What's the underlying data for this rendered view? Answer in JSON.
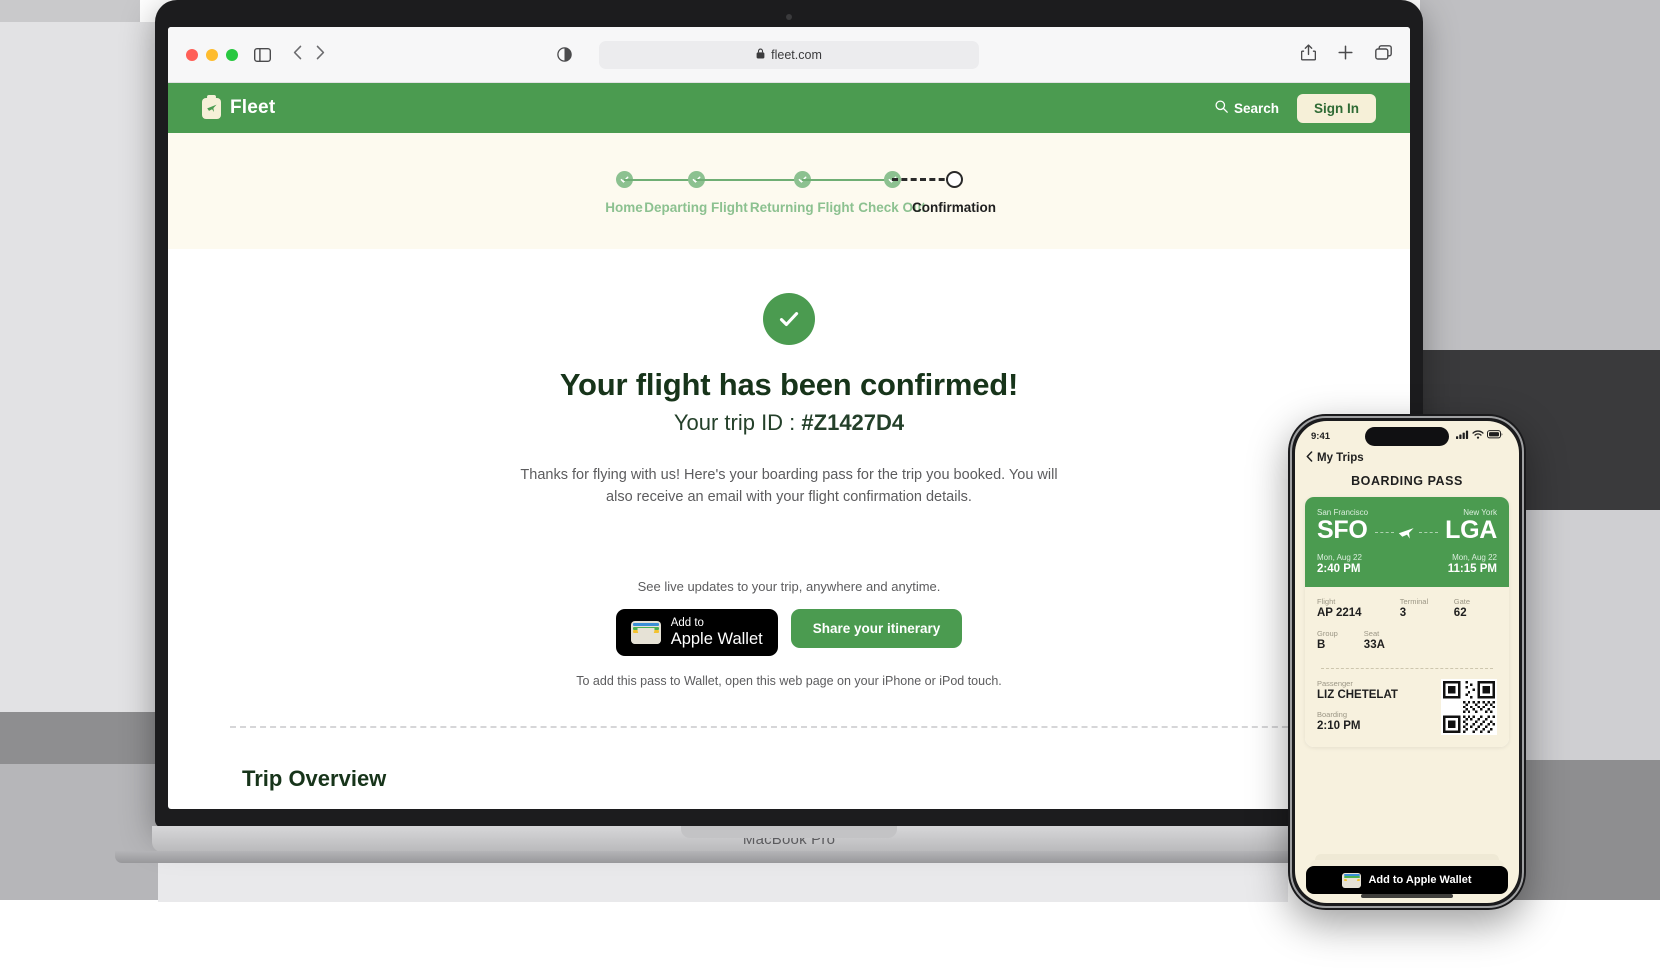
{
  "browser": {
    "url": "fleet.com",
    "lock_icon": "lock-icon",
    "sidebar_icon": "sidebar-icon",
    "back_icon": "chevron-left-icon",
    "forward_icon": "chevron-right-icon",
    "reader_icon": "reader-contrast-icon",
    "share_icon": "share-icon",
    "newtab_icon": "plus-icon",
    "tabs_icon": "tabs-icon",
    "traffic_lights": [
      "close",
      "minimize",
      "zoom"
    ]
  },
  "laptop": {
    "model_label": "MacBook Pro"
  },
  "site_nav": {
    "brand": "Fleet",
    "brand_icon": "briefcase-plane-icon",
    "search_label": "Search",
    "search_icon": "search-icon",
    "sign_in_label": "Sign In",
    "bg_color": "#4b9b50",
    "accent_cream": "#f6f0d8"
  },
  "stepper": {
    "steps": [
      {
        "label": "Home",
        "state": "done"
      },
      {
        "label": "Departing Flight",
        "state": "done"
      },
      {
        "label": "Returning Flight",
        "state": "done"
      },
      {
        "label": "Check Out",
        "state": "done"
      },
      {
        "label": "Confirmation",
        "state": "current"
      }
    ],
    "connectors": [
      "solid",
      "solid",
      "solid",
      "dashed"
    ],
    "done_color": "#8cc190",
    "current_color": "#1f1f1f"
  },
  "confirmation": {
    "check_icon": "check-circle-icon",
    "heading": "Your flight has been confirmed!",
    "trip_id_prefix": "Your trip ID : ",
    "trip_id": "#Z1427D4",
    "body": "Thanks for flying with us! Here's your boarding pass for the trip you booked. You will also receive an email with your flight confirmation details.",
    "live_updates_text": "See live updates to your trip, anywhere and anytime.",
    "wallet_button": {
      "line1": "Add to",
      "line2": "Apple Wallet",
      "icon": "apple-wallet-icon"
    },
    "share_button": "Share your itinerary",
    "wallet_note": "To add this pass to Wallet, open this web page on your iPhone or iPod touch.",
    "section_title": "Trip Overview"
  },
  "phone": {
    "status": {
      "time": "9:41",
      "cellular_icon": "signal-bars-icon",
      "wifi_icon": "wifi-icon",
      "battery_icon": "battery-icon"
    },
    "back_label": "My Trips",
    "back_icon": "chevron-left-icon",
    "title": "BOARDING PASS",
    "pass": {
      "origin_city": "San Francisco",
      "origin_code": "SFO",
      "origin_date": "Mon, Aug 22",
      "origin_time": "2:40 PM",
      "plane_icon": "airplane-icon",
      "dest_city": "New York",
      "dest_code": "LGA",
      "dest_date": "Mon, Aug 22",
      "dest_time": "11:15 PM",
      "details": [
        {
          "key": "Flight",
          "value": "AP 2214"
        },
        {
          "key": "Terminal",
          "value": "3"
        },
        {
          "key": "Gate",
          "value": "62"
        }
      ],
      "details2": [
        {
          "key": "Group",
          "value": "B"
        },
        {
          "key": "Seat",
          "value": "33A"
        }
      ],
      "passenger_key": "Passenger",
      "passenger_value": "LIZ CHETELAT",
      "boarding_key": "Boarding",
      "boarding_value": "2:10 PM",
      "qr_icon": "qr-code-icon",
      "card_color": "#4b9b50"
    },
    "wallet_button": {
      "label": "Add to Apple Wallet",
      "icon": "apple-wallet-icon"
    }
  }
}
